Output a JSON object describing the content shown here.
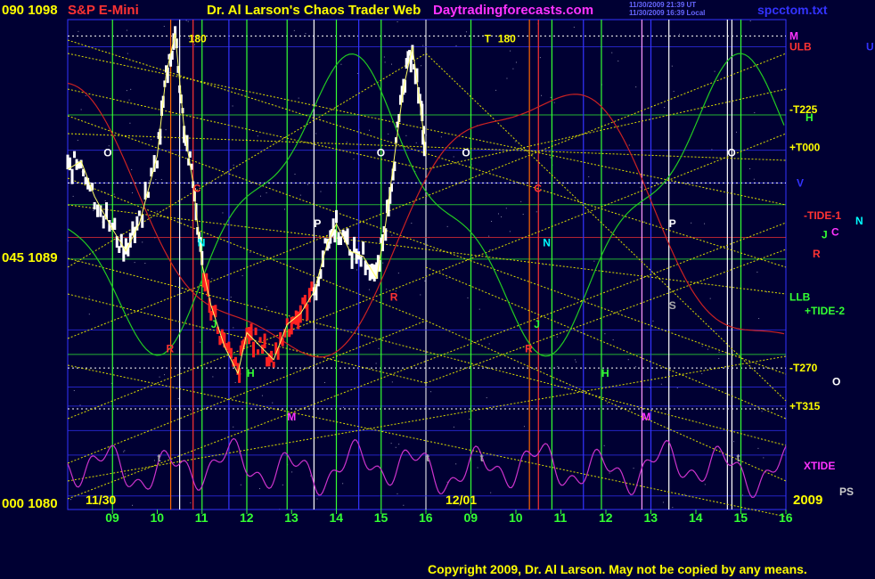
{
  "header": {
    "left_price": "090 1098",
    "instrument": "S&P E-Mini",
    "title": "Dr. Al Larson's Chaos Trader Web",
    "site": "Daytradingforecasts.com",
    "stamp1": "11/30/2009 21:39 UT",
    "stamp2": "11/30/2009 16:39 Local",
    "file": "spcctom.txt"
  },
  "y_labels": {
    "top": "090 1098",
    "mid": "045 1089",
    "bottom": "000 1080",
    "year": "2009",
    "ps": "PS"
  },
  "chart_data": {
    "type": "line",
    "title": "S&P E-Mini",
    "ylim": [
      1080,
      1098
    ],
    "dates": [
      "11/30",
      "12/01"
    ],
    "hour_ticks_day1": [
      "09",
      "10",
      "11",
      "12",
      "13",
      "14",
      "15",
      "16"
    ],
    "hour_ticks_day2": [
      "09",
      "10",
      "11",
      "12",
      "13",
      "14",
      "15",
      "16"
    ],
    "price_series": {
      "hours": [
        8.0,
        8.3,
        8.6,
        9.0,
        9.3,
        9.6,
        10.0,
        10.2,
        10.4,
        10.6,
        10.8,
        11.0,
        11.2,
        11.5,
        11.8,
        12.0,
        12.3,
        12.6,
        12.9,
        13.2,
        13.5,
        13.8,
        14.0,
        14.3,
        14.6,
        14.9,
        15.1,
        15.3,
        15.5,
        15.7,
        15.9,
        16.0
      ],
      "prices": [
        1092.5,
        1092.8,
        1091.5,
        1090.3,
        1089.5,
        1090.5,
        1093.0,
        1096.0,
        1097.5,
        1094.0,
        1092.0,
        1089.0,
        1087.5,
        1086.0,
        1085.0,
        1086.5,
        1086.0,
        1085.5,
        1086.8,
        1087.2,
        1088.0,
        1089.8,
        1090.5,
        1089.5,
        1089.3,
        1088.5,
        1090.5,
        1093.0,
        1095.5,
        1097.0,
        1094.5,
        1093.0
      ]
    },
    "right_labels": [
      {
        "text": "M",
        "color": "#ff33ff",
        "price": 1097.4
      },
      {
        "text": "ULB",
        "color": "#ff3333",
        "price": 1097.0
      },
      {
        "text": "U",
        "color": "#3333ff",
        "price": 1097.0
      },
      {
        "text": "-T225",
        "color": "#ffff00",
        "price": 1094.7
      },
      {
        "text": "H",
        "color": "#33ff33",
        "price": 1094.4
      },
      {
        "text": "+T000",
        "color": "#ffff00",
        "price": 1093.3
      },
      {
        "text": "V",
        "color": "#3333ff",
        "price": 1092.0
      },
      {
        "text": "-TIDE-1",
        "color": "#ff3333",
        "price": 1090.8
      },
      {
        "text": "N",
        "color": "#00ffff",
        "price": 1090.6
      },
      {
        "text": "J",
        "color": "#33ff33",
        "price": 1090.1
      },
      {
        "text": "C",
        "color": "#ff33ff",
        "price": 1090.2
      },
      {
        "text": "R",
        "color": "#ff3333",
        "price": 1089.4
      },
      {
        "text": "LLB",
        "color": "#33ff33",
        "price": 1087.8
      },
      {
        "text": "+TIDE-2",
        "color": "#33ff33",
        "price": 1087.3
      },
      {
        "text": "-T270",
        "color": "#ffff00",
        "price": 1085.2
      },
      {
        "text": "O",
        "color": "#ffffff",
        "price": 1084.7
      },
      {
        "text": "+T315",
        "color": "#ffff00",
        "price": 1083.8
      },
      {
        "text": "XTIDE",
        "color": "#ff33ff",
        "price": 1081.6
      }
    ],
    "in_chart_labels": [
      {
        "text": "180",
        "color": "#ffff00",
        "hour": 10.7,
        "price": 1097.3
      },
      {
        "text": "T",
        "color": "#ffff00",
        "hour": 33.3,
        "price": 1097.3
      },
      {
        "text": "180",
        "color": "#ffff00",
        "hour": 33.6,
        "price": 1097.3
      },
      {
        "text": "O",
        "color": "#ffffff",
        "hour": 8.8,
        "price": 1093.1
      },
      {
        "text": "O",
        "color": "#ffffff",
        "hour": 14.9,
        "price": 1093.1
      },
      {
        "text": "O",
        "color": "#ffffff",
        "hour": 32.8,
        "price": 1093.1
      },
      {
        "text": "O",
        "color": "#ffffff",
        "hour": 38.7,
        "price": 1093.1
      },
      {
        "text": "C",
        "color": "#ff3333",
        "hour": 10.8,
        "price": 1091.8
      },
      {
        "text": "C",
        "color": "#ff3333",
        "hour": 34.4,
        "price": 1091.8
      },
      {
        "text": "P",
        "color": "#ffffff",
        "hour": 13.5,
        "price": 1090.5
      },
      {
        "text": "P",
        "color": "#ffffff",
        "hour": 37.4,
        "price": 1090.5
      },
      {
        "text": "N",
        "color": "#00ffff",
        "hour": 10.9,
        "price": 1089.8
      },
      {
        "text": "N",
        "color": "#00ffff",
        "hour": 34.6,
        "price": 1089.8
      },
      {
        "text": "R",
        "color": "#ff3333",
        "hour": 15.2,
        "price": 1087.8
      },
      {
        "text": "S",
        "color": "#aaaaaa",
        "hour": 37.4,
        "price": 1087.5
      },
      {
        "text": "J",
        "color": "#33ff33",
        "hour": 11.2,
        "price": 1086.8
      },
      {
        "text": "J",
        "color": "#33ff33",
        "hour": 34.4,
        "price": 1086.8
      },
      {
        "text": "R",
        "color": "#ff3333",
        "hour": 10.2,
        "price": 1085.9
      },
      {
        "text": "R",
        "color": "#ff3333",
        "hour": 34.2,
        "price": 1085.9
      },
      {
        "text": "H",
        "color": "#33ff33",
        "hour": 12.0,
        "price": 1085.0
      },
      {
        "text": "H",
        "color": "#33ff33",
        "hour": 35.9,
        "price": 1085.0
      },
      {
        "text": "M",
        "color": "#ff33ff",
        "hour": 12.9,
        "price": 1083.4
      },
      {
        "text": "M",
        "color": "#ff33ff",
        "hour": 36.8,
        "price": 1083.4
      },
      {
        "text": "t",
        "color": "#aaaaaa",
        "hour": 10.0,
        "price": 1081.9
      },
      {
        "text": "t",
        "color": "#aaaaaa",
        "hour": 16.0,
        "price": 1081.9
      },
      {
        "text": "t",
        "color": "#aaaaaa",
        "hour": 33.2,
        "price": 1081.9
      },
      {
        "text": "t",
        "color": "#aaaaaa",
        "hour": 38.9,
        "price": 1081.9
      }
    ]
  },
  "footer": {
    "copyright": "Copyright 2009, Dr. Al Larson. May not be copied by any means."
  }
}
